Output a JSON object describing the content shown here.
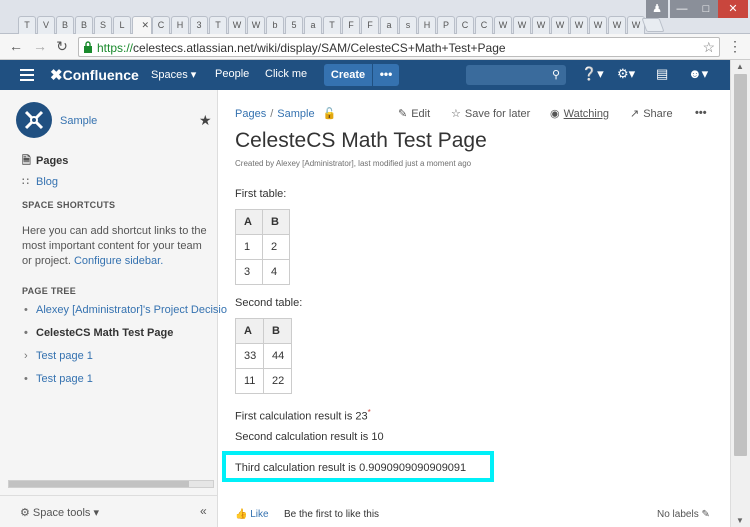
{
  "browser": {
    "tabs": [
      "T",
      "V",
      "B",
      "B",
      "S",
      "L",
      "",
      "C",
      "H",
      "3",
      "T",
      "W",
      "W",
      "b",
      "5",
      "a",
      "T",
      "F",
      "F",
      "a",
      "s",
      "H",
      "P",
      "C",
      "C",
      "W",
      "W",
      "W",
      "W",
      "W",
      "W",
      "W",
      "W"
    ],
    "url_protocol": "https://",
    "url_rest": "celestecs.atlassian.net/wiki/display/SAM/CelesteCS+Math+Test+Page"
  },
  "header": {
    "logo": "Confluence",
    "spaces": "Spaces ▾",
    "people": "People",
    "click_me": "Click me",
    "create": "Create",
    "more": "•••"
  },
  "sidebar": {
    "space_name": "Sample",
    "pages": "Pages",
    "blog": "Blog",
    "shortcuts_heading": "SPACE SHORTCUTS",
    "shortcuts_text": "Here you can add shortcut links to the most important content for your team or project.",
    "configure_link": "Configure sidebar.",
    "tree_heading": "PAGE TREE",
    "tree": [
      {
        "label": "Alexey [Administrator]'s Project Decisio",
        "marker": "•",
        "current": false
      },
      {
        "label": "CelesteCS Math Test Page",
        "marker": "•",
        "current": true
      },
      {
        "label": "Test page 1",
        "marker": "›",
        "current": false
      },
      {
        "label": "Test page 1",
        "marker": "•",
        "current": false
      }
    ],
    "space_tools": "Space tools ▾",
    "collapse": "«"
  },
  "page": {
    "breadcrumb": [
      "Pages",
      "Sample"
    ],
    "actions": {
      "edit": "Edit",
      "save_later": "Save for later",
      "watching": "Watching",
      "share": "Share",
      "more": "•••"
    },
    "title": "CelesteCS Math Test Page",
    "byline": "Created by Alexey [Administrator], last modified just a moment ago",
    "first_table_label": "First table:",
    "table1": {
      "headers": [
        "A",
        "B"
      ],
      "rows": [
        [
          "1",
          "2"
        ],
        [
          "3",
          "4"
        ]
      ]
    },
    "second_table_label": "Second table:",
    "table2": {
      "headers": [
        "A",
        "B"
      ],
      "rows": [
        [
          "33",
          "44"
        ],
        [
          "11",
          "22"
        ]
      ]
    },
    "calc1": "First calculation result is 23",
    "calc1_marker": "*",
    "calc2": "Second calculation result is 10",
    "calc3": "Third calculation result is 0.9090909090909091"
  },
  "footer": {
    "like": "Like",
    "first_to_like": "Be the first to like this",
    "no_labels": "No labels"
  },
  "colors": {
    "header_bg": "#205081",
    "link": "#3572b0",
    "highlight": "#00f0f8"
  }
}
